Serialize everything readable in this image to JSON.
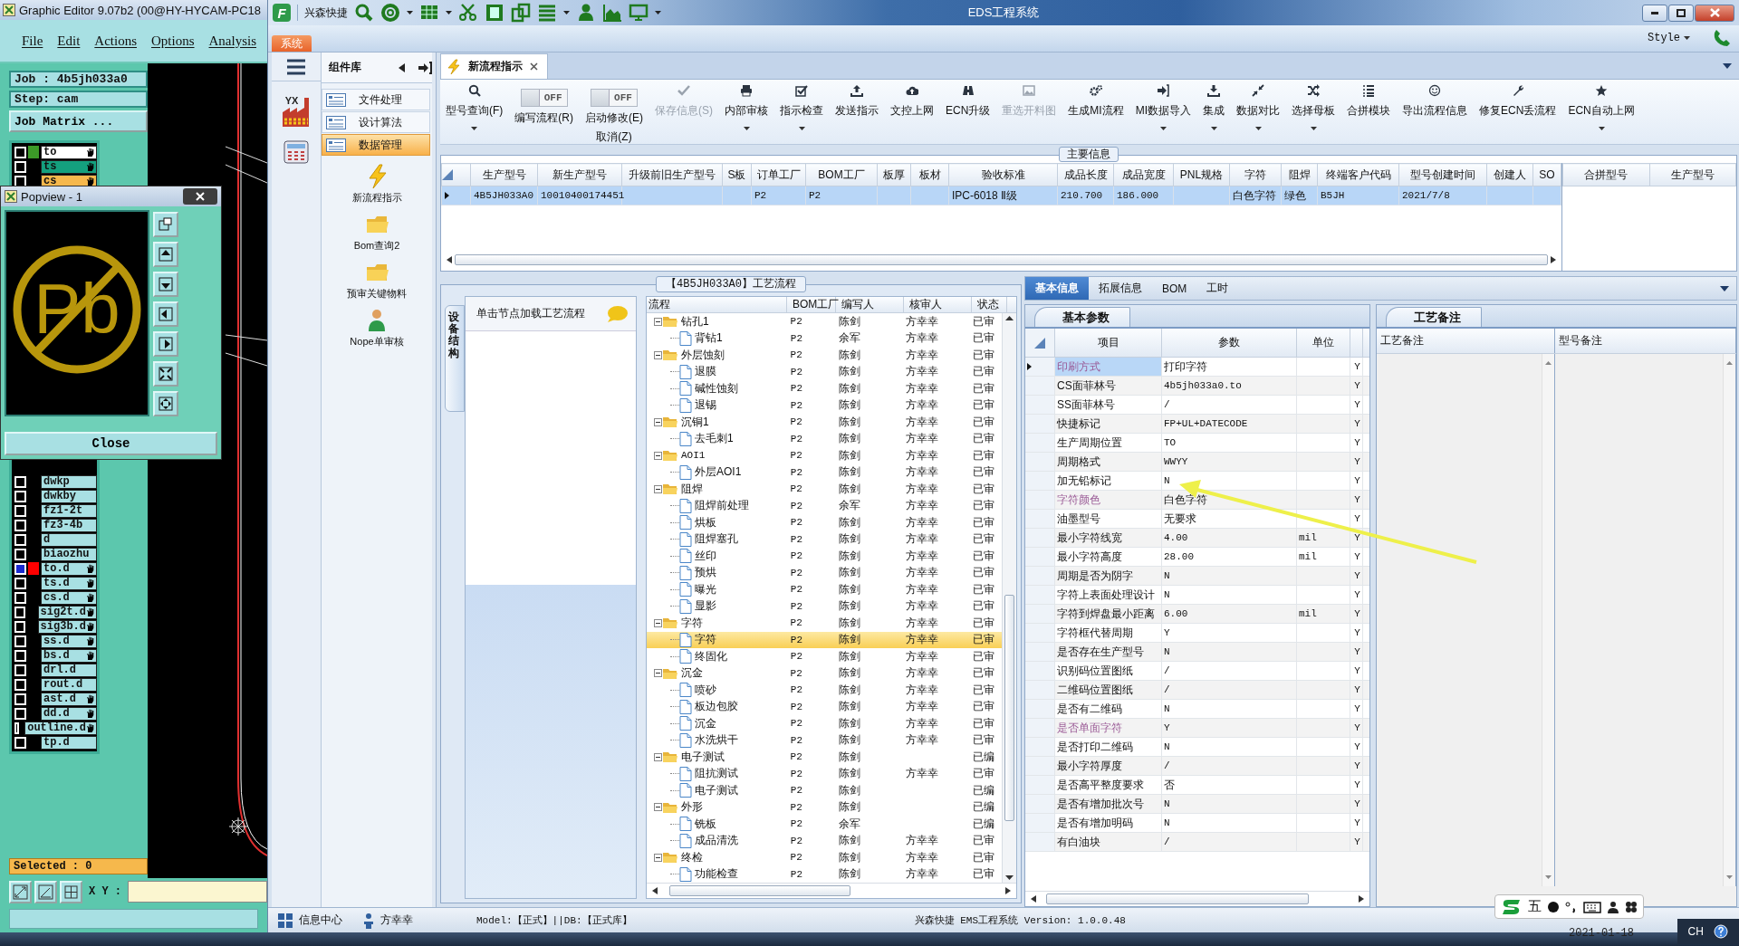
{
  "editor": {
    "title": "Graphic Editor 9.07b2 (00@HY-HYCAM-PC18",
    "menu": [
      "File",
      "Edit",
      "Actions",
      "Options",
      "Analysis"
    ],
    "job": "Job : 4b5jh033a0",
    "step": "Step: cam",
    "matrix_button": "Job Matrix ...",
    "layers_top": [
      {
        "name": "to",
        "color": "#ffffff",
        "swatch": {
          "color": "#3c9a28"
        },
        "affected": true,
        "selected": false
      },
      {
        "name": "ts",
        "color": "#14a07e",
        "affected": true,
        "selected": false
      },
      {
        "name": "cs",
        "color": "#f6b84c",
        "affected": true,
        "selected": false
      }
    ],
    "layers_bottom": [
      {
        "name": "dwkp",
        "affected": false,
        "selected": false
      },
      {
        "name": "dwkby",
        "affected": false,
        "selected": false
      },
      {
        "name": "fz1-2t",
        "affected": false,
        "selected": false
      },
      {
        "name": "fz3-4b",
        "affected": false,
        "selected": false
      },
      {
        "name": "d",
        "affected": false,
        "selected": false
      },
      {
        "name": "biaozhu",
        "affected": false,
        "selected": false
      },
      {
        "name": "to.d",
        "swatch": {
          "color": "#ff0000"
        },
        "affected": true,
        "selected": true
      },
      {
        "name": "ts.d",
        "affected": true,
        "selected": false
      },
      {
        "name": "cs.d",
        "affected": true,
        "selected": false
      },
      {
        "name": "sig2t.d",
        "affected": true,
        "selected": false
      },
      {
        "name": "sig3b.d",
        "affected": true,
        "selected": false
      },
      {
        "name": "ss.d",
        "affected": true,
        "selected": false
      },
      {
        "name": "bs.d",
        "affected": true,
        "selected": false
      },
      {
        "name": "drl.d",
        "affected": false,
        "selected": false
      },
      {
        "name": "rout.d",
        "affected": false,
        "selected": false
      },
      {
        "name": "ast.d",
        "affected": true,
        "selected": false
      },
      {
        "name": "dd.d",
        "affected": true,
        "selected": false
      },
      {
        "name": "outline.d",
        "affected": true,
        "selected": false
      },
      {
        "name": "tp.d",
        "affected": false,
        "selected": false
      }
    ],
    "selected_count": "Selected : 0",
    "xy_label": "X Y :"
  },
  "popview": {
    "title": "Popview - 1",
    "symbol": "Pb",
    "close_button": "Close"
  },
  "app": {
    "logo": "F",
    "brand": "兴森快捷",
    "title": "EDS工程系统",
    "ribbon_tab": "系统",
    "style_menu": "Style"
  },
  "nav": {
    "badge": "YX",
    "header": "组件库",
    "modules": [
      {
        "label": "文件处理",
        "selected": false
      },
      {
        "label": "设计算法",
        "selected": false
      },
      {
        "label": "数据管理",
        "selected": true
      }
    ],
    "tools": [
      {
        "label": "新流程指示",
        "kind": "bolt"
      },
      {
        "label": "Bom查询2",
        "kind": "folder"
      },
      {
        "label": "预审关键物料",
        "kind": "folder"
      },
      {
        "label": "Nope单审核",
        "kind": "person"
      }
    ]
  },
  "doc_tabs": [
    {
      "label": "新流程指示",
      "selected": true
    }
  ],
  "toolbar": [
    {
      "kind": "button",
      "label": "型号查询(F)",
      "dropdown": true,
      "disabled": false
    },
    {
      "kind": "toggle",
      "label": "编写流程(R)",
      "switch_text": "OFF",
      "on": false
    },
    {
      "kind": "toggle",
      "label": "启动修改(E)",
      "sublabel": "取消(Z)",
      "switch_text": "OFF",
      "on": false
    },
    {
      "kind": "button",
      "label": "保存信息(S)",
      "dropdown": false,
      "disabled": true
    },
    {
      "kind": "button",
      "label": "内部审核",
      "dropdown": true,
      "disabled": false
    },
    {
      "kind": "button",
      "label": "指示检查",
      "dropdown": true,
      "disabled": false
    },
    {
      "kind": "button",
      "label": "发送指示",
      "dropdown": false,
      "disabled": false
    },
    {
      "kind": "button",
      "label": "文控上网",
      "dropdown": false,
      "disabled": false
    },
    {
      "kind": "button",
      "label": "ECN升级",
      "dropdown": false,
      "disabled": false
    },
    {
      "kind": "button",
      "label": "重选开料图",
      "dropdown": false,
      "disabled": true
    },
    {
      "kind": "button",
      "label": "生成MI流程",
      "dropdown": false,
      "disabled": false
    },
    {
      "kind": "button",
      "label": "MI数据导入",
      "dropdown": true,
      "disabled": false
    },
    {
      "kind": "button",
      "label": "集成",
      "dropdown": true,
      "disabled": false
    },
    {
      "kind": "button",
      "label": "数据对比",
      "dropdown": true,
      "disabled": false
    },
    {
      "kind": "button",
      "label": "选择母板",
      "dropdown": true,
      "disabled": false
    },
    {
      "kind": "button",
      "label": "合拼模块",
      "dropdown": false,
      "disabled": false
    },
    {
      "kind": "button",
      "label": "导出流程信息",
      "dropdown": false,
      "disabled": false
    },
    {
      "kind": "button",
      "label": "修复ECN丢流程",
      "dropdown": false,
      "disabled": false
    },
    {
      "kind": "button",
      "label": "ECN自动上网",
      "dropdown": true,
      "disabled": false
    }
  ],
  "main_info": {
    "legend": "主要信息",
    "columns": [
      "生产型号",
      "新生产型号",
      "升级前旧生产型号",
      "S板",
      "订单工厂",
      "BOM工厂",
      "板厚",
      "板材",
      "验收标准",
      "成品长度",
      "成品宽度",
      "PNL规格",
      "字符",
      "阻焊",
      "终端客户代码",
      "型号创建时间",
      "创建人",
      "SO"
    ],
    "rows": [
      {
        "selected": true,
        "cells": [
          "4B5JH033A0",
          "10010400174451",
          null,
          null,
          "P2",
          "P2",
          null,
          null,
          "IPC-6018 Ⅱ级",
          "210.700",
          "186.000",
          null,
          "白色字符",
          "绿色",
          "B5JH",
          "2021/7/8",
          null,
          null
        ]
      }
    ],
    "side_columns": [
      "合拼型号",
      "生产型号"
    ]
  },
  "process": {
    "legend": "【4B5JH033A0】工艺流程",
    "side_tab": "设备结构",
    "hint": "单击节点加载工艺流程",
    "columns": [
      "流程",
      "BOM工厂",
      "编写人",
      "核审人",
      "状态"
    ],
    "tree": [
      {
        "name": "钻孔1",
        "bom": "P2",
        "writer": "陈剑",
        "reviewer": "方幸幸",
        "status": "已审",
        "expanded": true,
        "selected": false,
        "children": [
          {
            "name": "背钻1",
            "bom": "P2",
            "writer": "余军",
            "reviewer": "方幸幸",
            "status": "已审",
            "selected": false
          }
        ]
      },
      {
        "name": "外层蚀刻",
        "bom": "P2",
        "writer": "陈剑",
        "reviewer": "方幸幸",
        "status": "已审",
        "expanded": true,
        "selected": false,
        "children": [
          {
            "name": "退膜",
            "bom": "P2",
            "writer": "陈剑",
            "reviewer": "方幸幸",
            "status": "已审",
            "selected": false
          },
          {
            "name": "碱性蚀刻",
            "bom": "P2",
            "writer": "陈剑",
            "reviewer": "方幸幸",
            "status": "已审",
            "selected": false
          },
          {
            "name": "退锡",
            "bom": "P2",
            "writer": "陈剑",
            "reviewer": "方幸幸",
            "status": "已审",
            "selected": false
          }
        ]
      },
      {
        "name": "沉铜1",
        "bom": "P2",
        "writer": "陈剑",
        "reviewer": "方幸幸",
        "status": "已审",
        "expanded": true,
        "selected": false,
        "children": [
          {
            "name": "去毛刺1",
            "bom": "P2",
            "writer": "陈剑",
            "reviewer": "方幸幸",
            "status": "已审",
            "selected": false
          }
        ]
      },
      {
        "name": "AOI1",
        "bom": "P2",
        "writer": "陈剑",
        "reviewer": "方幸幸",
        "status": "已审",
        "expanded": true,
        "selected": false,
        "children": [
          {
            "name": "外层AOI1",
            "bom": "P2",
            "writer": "陈剑",
            "reviewer": "方幸幸",
            "status": "已审",
            "selected": false
          }
        ]
      },
      {
        "name": "阻焊",
        "bom": "P2",
        "writer": "陈剑",
        "reviewer": "方幸幸",
        "status": "已审",
        "expanded": true,
        "selected": false,
        "children": [
          {
            "name": "阻焊前处理",
            "bom": "P2",
            "writer": "余军",
            "reviewer": "方幸幸",
            "status": "已审",
            "selected": false
          },
          {
            "name": "烘板",
            "bom": "P2",
            "writer": "陈剑",
            "reviewer": "方幸幸",
            "status": "已审",
            "selected": false
          },
          {
            "name": "阻焊塞孔",
            "bom": "P2",
            "writer": "陈剑",
            "reviewer": "方幸幸",
            "status": "已审",
            "selected": false
          },
          {
            "name": "丝印",
            "bom": "P2",
            "writer": "陈剑",
            "reviewer": "方幸幸",
            "status": "已审",
            "selected": false
          },
          {
            "name": "预烘",
            "bom": "P2",
            "writer": "陈剑",
            "reviewer": "方幸幸",
            "status": "已审",
            "selected": false
          },
          {
            "name": "曝光",
            "bom": "P2",
            "writer": "陈剑",
            "reviewer": "方幸幸",
            "status": "已审",
            "selected": false
          },
          {
            "name": "显影",
            "bom": "P2",
            "writer": "陈剑",
            "reviewer": "方幸幸",
            "status": "已审",
            "selected": false
          }
        ]
      },
      {
        "name": "字符",
        "bom": "P2",
        "writer": "陈剑",
        "reviewer": "方幸幸",
        "status": "已审",
        "expanded": true,
        "selected": false,
        "children": [
          {
            "name": "字符",
            "bom": "P2",
            "writer": "陈剑",
            "reviewer": "方幸幸",
            "status": "已审",
            "selected": true
          },
          {
            "name": "终固化",
            "bom": "P2",
            "writer": "陈剑",
            "reviewer": "方幸幸",
            "status": "已审",
            "selected": false
          }
        ]
      },
      {
        "name": "沉金",
        "bom": "P2",
        "writer": "陈剑",
        "reviewer": "方幸幸",
        "status": "已审",
        "expanded": true,
        "selected": false,
        "children": [
          {
            "name": "喷砂",
            "bom": "P2",
            "writer": "陈剑",
            "reviewer": "方幸幸",
            "status": "已审",
            "selected": false
          },
          {
            "name": "板边包胶",
            "bom": "P2",
            "writer": "陈剑",
            "reviewer": "方幸幸",
            "status": "已审",
            "selected": false
          },
          {
            "name": "沉金",
            "bom": "P2",
            "writer": "陈剑",
            "reviewer": "方幸幸",
            "status": "已审",
            "selected": false
          },
          {
            "name": "水洗烘干",
            "bom": "P2",
            "writer": "陈剑",
            "reviewer": "方幸幸",
            "status": "已审",
            "selected": false
          }
        ]
      },
      {
        "name": "电子测试",
        "bom": "P2",
        "writer": "陈剑",
        "status": "已编",
        "expanded": true,
        "selected": false,
        "children": [
          {
            "name": "阻抗测试",
            "bom": "P2",
            "writer": "陈剑",
            "reviewer": "方幸幸",
            "status": "已审",
            "selected": false
          },
          {
            "name": "电子测试",
            "bom": "P2",
            "writer": "陈剑",
            "status": "已编",
            "selected": false
          }
        ]
      },
      {
        "name": "外形",
        "bom": "P2",
        "writer": "陈剑",
        "status": "已编",
        "expanded": true,
        "selected": false,
        "children": [
          {
            "name": "铣板",
            "bom": "P2",
            "writer": "余军",
            "status": "已编",
            "selected": false
          },
          {
            "name": "成品清洗",
            "bom": "P2",
            "writer": "陈剑",
            "reviewer": "方幸幸",
            "status": "已审",
            "selected": false
          }
        ]
      },
      {
        "name": "终检",
        "bom": "P2",
        "writer": "陈剑",
        "reviewer": "方幸幸",
        "status": "已审",
        "expanded": true,
        "selected": false,
        "children": [
          {
            "name": "功能检查",
            "bom": "P2",
            "writer": "陈剑",
            "reviewer": "方幸幸",
            "status": "已审",
            "selected": false
          }
        ]
      }
    ]
  },
  "params": {
    "tabs": [
      {
        "label": "基本信息",
        "selected": true
      },
      {
        "label": "拓展信息",
        "selected": false
      },
      {
        "label": "BOM",
        "selected": false
      },
      {
        "label": "工时",
        "selected": false
      }
    ],
    "subtab": "基本参数",
    "columns": [
      "项目",
      "参数",
      "单位"
    ],
    "rows": [
      {
        "item": "印刷方式",
        "value": "打印字符",
        "column_4": "Y",
        "flagged": true,
        "selected": true
      },
      {
        "item": "CS面菲林号",
        "value": "4b5jh033a0.to",
        "column_4": "Y",
        "flagged": false,
        "selected": false
      },
      {
        "item": "SS面菲林号",
        "value": "/",
        "column_4": "Y",
        "flagged": false,
        "selected": false
      },
      {
        "item": "快捷标记",
        "value": "FP+UL+DATECODE",
        "column_4": "Y",
        "flagged": false,
        "selected": false
      },
      {
        "item": "生产周期位置",
        "value": "TO",
        "column_4": "Y",
        "flagged": false,
        "selected": false
      },
      {
        "item": "周期格式",
        "value": "WWYY",
        "column_4": "Y",
        "flagged": false,
        "selected": false
      },
      {
        "item": "加无铅标记",
        "value": "N",
        "column_4": "Y",
        "flagged": false,
        "selected": false
      },
      {
        "item": "字符颜色",
        "value": "白色字符",
        "column_4": "Y",
        "flagged": true,
        "selected": false
      },
      {
        "item": "油墨型号",
        "value": "无要求",
        "column_4": "Y",
        "flagged": false,
        "selected": false
      },
      {
        "item": "最小字符线宽",
        "value": "4.00",
        "unit": "mil",
        "column_4": "Y",
        "flagged": false,
        "selected": false
      },
      {
        "item": "最小字符高度",
        "value": "28.00",
        "unit": "mil",
        "column_4": "Y",
        "flagged": false,
        "selected": false
      },
      {
        "item": "周期是否为阴字",
        "value": "N",
        "column_4": "Y",
        "flagged": false,
        "selected": false
      },
      {
        "item": "字符上表面处理设计",
        "value": "N",
        "column_4": "Y",
        "flagged": false,
        "selected": false
      },
      {
        "item": "字符到焊盘最小距离",
        "value": "6.00",
        "unit": "mil",
        "column_4": "Y",
        "flagged": false,
        "selected": false
      },
      {
        "item": "字符框代替周期",
        "value": "Y",
        "column_4": "Y",
        "flagged": false,
        "selected": false
      },
      {
        "item": "是否存在生产型号",
        "value": "N",
        "column_4": "Y",
        "flagged": false,
        "selected": false
      },
      {
        "item": "识别码位置图纸",
        "value": "/",
        "column_4": "Y",
        "flagged": false,
        "selected": false
      },
      {
        "item": "二维码位置图纸",
        "value": "/",
        "column_4": "Y",
        "flagged": false,
        "selected": false
      },
      {
        "item": "是否有二维码",
        "value": "N",
        "column_4": "Y",
        "flagged": false,
        "selected": false
      },
      {
        "item": "是否单面字符",
        "value": "Y",
        "column_4": "Y",
        "flagged": true,
        "selected": false
      },
      {
        "item": "是否打印二维码",
        "value": "N",
        "column_4": "Y",
        "flagged": false,
        "selected": false
      },
      {
        "item": "最小字符厚度",
        "value": "/",
        "column_4": "Y",
        "flagged": false,
        "selected": false
      },
      {
        "item": "是否高平整度要求",
        "value": "否",
        "column_4": "Y",
        "flagged": false,
        "selected": false
      },
      {
        "item": "是否有增加批次号",
        "value": "N",
        "column_4": "Y",
        "flagged": false,
        "selected": false
      },
      {
        "item": "是否有增加明码",
        "value": "N",
        "column_4": "Y",
        "flagged": false,
        "selected": false
      },
      {
        "item": "有白油块",
        "value": "/",
        "column_4": "Y",
        "flagged": false,
        "selected": false
      }
    ]
  },
  "notes": {
    "tab": "工艺备注",
    "columns": [
      "工艺备注",
      "型号备注"
    ]
  },
  "status_bar": {
    "info_center": "信息中心",
    "user": "方幸幸",
    "model": "Model:【正式】||DB:【正式库】",
    "version": "兴森快捷 EMS工程系统 Version: 1.0.0.48"
  },
  "tray": {
    "ime_mode": "五",
    "date": "2021-01-18",
    "lang": "CH"
  }
}
